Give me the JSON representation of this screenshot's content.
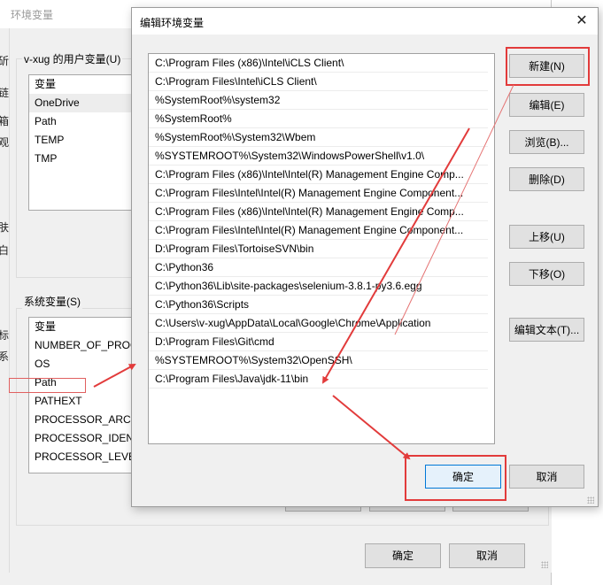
{
  "background_window": {
    "title": "环境变量",
    "left_strip_chars": [
      "斫",
      "链",
      "箱",
      "观",
      "肤",
      "白",
      "标",
      "系"
    ],
    "user_vars": {
      "group_label": "v-xug 的用户变量(U)",
      "column_header": "变量",
      "rows": [
        "OneDrive",
        "Path",
        "TEMP",
        "TMP"
      ],
      "selected_index": 0
    },
    "system_vars": {
      "group_label": "系统变量(S)",
      "column_header": "变量",
      "rows": [
        "NUMBER_OF_PROC",
        "OS",
        "Path",
        "PATHEXT",
        "PROCESSOR_ARCH",
        "PROCESSOR_IDENT",
        "PROCESSOR_LEVEL"
      ],
      "highlighted_index": 2
    },
    "ok_label": "确定",
    "cancel_label": "取消"
  },
  "dialog": {
    "title": "编辑环境变量",
    "close_icon": "close-icon",
    "paths": [
      "C:\\Program Files (x86)\\Intel\\iCLS Client\\",
      "C:\\Program Files\\Intel\\iCLS Client\\",
      "%SystemRoot%\\system32",
      "%SystemRoot%",
      "%SystemRoot%\\System32\\Wbem",
      "%SYSTEMROOT%\\System32\\WindowsPowerShell\\v1.0\\",
      "C:\\Program Files (x86)\\Intel\\Intel(R) Management Engine Comp...",
      "C:\\Program Files\\Intel\\Intel(R) Management Engine Component...",
      "C:\\Program Files (x86)\\Intel\\Intel(R) Management Engine Comp...",
      "C:\\Program Files\\Intel\\Intel(R) Management Engine Component...",
      "D:\\Program Files\\TortoiseSVN\\bin",
      "C:\\Python36",
      "C:\\Python36\\Lib\\site-packages\\selenium-3.8.1-py3.6.egg",
      "C:\\Python36\\Scripts",
      "C:\\Users\\v-xug\\AppData\\Local\\Google\\Chrome\\Application",
      "D:\\Program Files\\Git\\cmd",
      "%SYSTEMROOT%\\System32\\OpenSSH\\",
      "C:\\Program Files\\Java\\jdk-11\\bin"
    ],
    "buttons": {
      "new": "新建(N)",
      "edit": "编辑(E)",
      "browse": "浏览(B)...",
      "delete": "删除(D)",
      "move_up": "上移(U)",
      "move_down": "下移(O)",
      "edit_text": "编辑文本(T)...",
      "ok": "确定",
      "cancel": "取消"
    }
  },
  "annotations": {
    "highlight_color": "#e23b3b"
  }
}
